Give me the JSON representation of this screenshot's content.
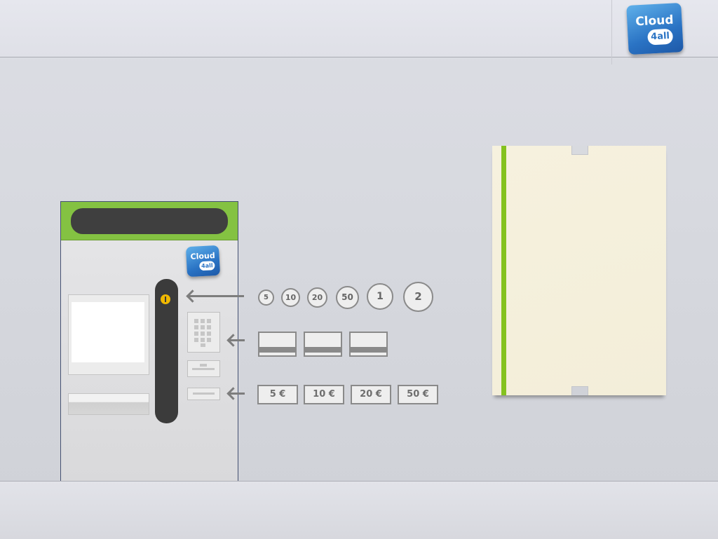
{
  "header": {
    "logo": {
      "line1": "Cloud",
      "line2": "4all",
      "icon": "cloud4all-logo"
    }
  },
  "machine": {
    "logo": {
      "line1": "Cloud",
      "line2": "4all"
    },
    "display_text": "",
    "colors": {
      "header": "#84c242",
      "display": "#3f3f3f",
      "slot": "#3b3b3b",
      "indicator": "#f0b800"
    }
  },
  "payment": {
    "coins": [
      "5",
      "10",
      "20",
      "50",
      "1",
      "2"
    ],
    "cards": [
      "card-1",
      "card-2",
      "card-3"
    ],
    "notes": [
      "5 €",
      "10 €",
      "20 €",
      "50 €"
    ]
  },
  "ticket": {
    "colors": {
      "paper": "#f4efdb",
      "stripe": "#84c21f"
    }
  }
}
